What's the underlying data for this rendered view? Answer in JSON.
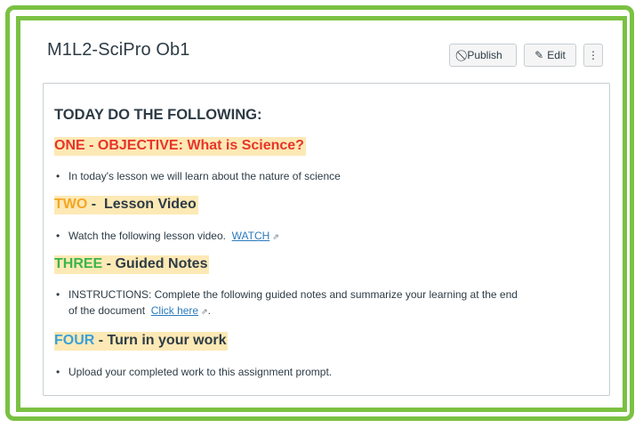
{
  "module": {
    "title": "M1L2-SciPro Ob1",
    "publish_label": "Publish",
    "edit_label": "Edit",
    "more_label": "⋮"
  },
  "content": {
    "heading": "TODAY DO THE FOLLOWING:",
    "sections": [
      {
        "number": "ONE",
        "separator": " - ",
        "title": "OBJECTIVE: What is Science?",
        "number_color": "#e8352a",
        "bullet": "In today's lesson we will learn about the nature of science"
      },
      {
        "number": "TWO",
        "separator": " -  ",
        "title": "Lesson Video",
        "number_color": "#f5a623",
        "bullet": "Watch the following lesson video.",
        "link": "WATCH"
      },
      {
        "number": "THREE",
        "separator": " - ",
        "title": "Guided Notes",
        "number_color": "#3ab54a",
        "bullet": "INSTRUCTIONS:  Complete the following guided notes and summarize your learning at the end",
        "bullet_cont": "of the document",
        "link": "Click here",
        "after_link": "."
      },
      {
        "number": "FOUR",
        "separator": " - ",
        "title": "Turn in your work",
        "number_color": "#3aa0d8",
        "bullet": "Upload your completed work to this assignment prompt."
      }
    ]
  },
  "icons": {
    "publish": "ban-icon",
    "edit": "pencil-icon",
    "external": "external-link-icon"
  },
  "colors": {
    "border": "#7ac143",
    "highlight": "#fde9b5",
    "link": "#2b7abc"
  }
}
